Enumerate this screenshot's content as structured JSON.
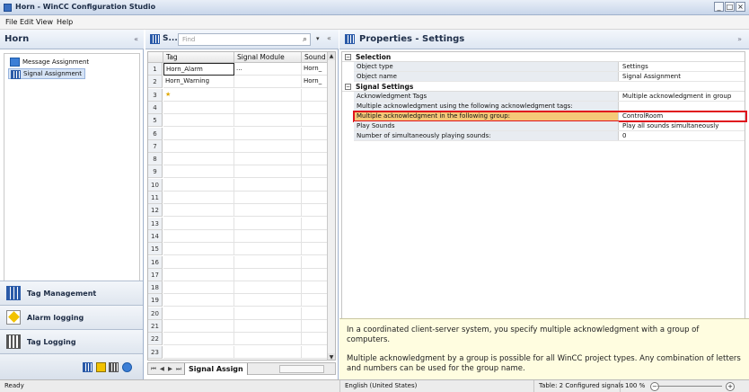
{
  "window": {
    "title": "Horn - WinCC Configuration Studio",
    "controls": [
      "_",
      "□",
      "×"
    ]
  },
  "menu": [
    "File",
    "Edit",
    "View",
    "Help"
  ],
  "nav": {
    "title": "Horn",
    "collapse_glyph": "«",
    "tree": [
      {
        "label": "Message Assignment",
        "icon": "message-icon"
      },
      {
        "label": "Signal Assignment",
        "icon": "signal-icon",
        "selected": true
      }
    ],
    "sep": ".....",
    "buttons": [
      {
        "label": "Tag Management",
        "icon": "tag-management-icon"
      },
      {
        "label": "Alarm logging",
        "icon": "alarm-logging-icon"
      },
      {
        "label": "Tag Logging",
        "icon": "tag-logging-icon"
      }
    ]
  },
  "grid": {
    "title": "S...",
    "find_placeholder": "Find",
    "search_glyph": "⌕",
    "dropdown_glyph": "▾",
    "expand_glyph": "«",
    "columns": [
      "Tag",
      "Signal Module",
      "Sound"
    ],
    "rows": [
      [
        "Horn_Alarm",
        "...",
        "Horn_"
      ],
      [
        "Horn_Warning",
        "",
        "Horn_"
      ],
      [
        "★",
        "",
        ""
      ],
      [
        "",
        "",
        ""
      ],
      [
        "",
        "",
        ""
      ],
      [
        "",
        "",
        ""
      ],
      [
        "",
        "",
        ""
      ],
      [
        "",
        "",
        ""
      ],
      [
        "",
        "",
        ""
      ],
      [
        "",
        "",
        ""
      ],
      [
        "",
        "",
        ""
      ],
      [
        "",
        "",
        ""
      ],
      [
        "",
        "",
        ""
      ],
      [
        "",
        "",
        ""
      ],
      [
        "",
        "",
        ""
      ],
      [
        "",
        "",
        ""
      ],
      [
        "",
        "",
        ""
      ],
      [
        "",
        "",
        ""
      ],
      [
        "",
        "",
        ""
      ],
      [
        "",
        "",
        ""
      ],
      [
        "",
        "",
        ""
      ],
      [
        "",
        "",
        ""
      ],
      [
        "",
        "",
        ""
      ]
    ],
    "row_numbers": [
      "1",
      "2",
      "3",
      "4",
      "5",
      "6",
      "7",
      "8",
      "9",
      "10",
      "11",
      "12",
      "13",
      "14",
      "15",
      "16",
      "17",
      "18",
      "19",
      "20",
      "21",
      "22",
      "23"
    ],
    "tab_label": "Signal Assign",
    "tab_nav": "⏮ ◀ ▶ ⏭"
  },
  "properties": {
    "title": "Properties - Settings",
    "expand_glyph": "»",
    "categories": [
      {
        "name": "Selection",
        "rows": [
          {
            "key": "Object type",
            "value": "Settings"
          },
          {
            "key": "Object name",
            "value": "Signal Assignment"
          }
        ]
      },
      {
        "name": "Signal Settings",
        "rows": [
          {
            "key": "Acknowledgment Tags",
            "value": "Multiple acknowledgment in group"
          },
          {
            "key": "Multiple acknowledgment using the following acknowledgment tags:",
            "value": ""
          },
          {
            "key": "Multiple acknowledgment in the following group:",
            "value": "ControlRoom",
            "highlighted": true
          },
          {
            "key": "Play Sounds",
            "value": "Play all sounds simultaneously"
          },
          {
            "key": "Number of simultaneously playing sounds:",
            "value": "0"
          }
        ]
      }
    ],
    "description": [
      "In a coordinated client-server system, you specify multiple acknowledgment with a group of computers.",
      "Multiple acknowledgment by a group is possible for all WinCC project types. Any combination of letters and numbers can be used for the group name."
    ]
  },
  "status": {
    "ready": "Ready",
    "language": "English (United States)",
    "table_info": "Table: 2 Configured signals",
    "zoom": "100 %"
  }
}
